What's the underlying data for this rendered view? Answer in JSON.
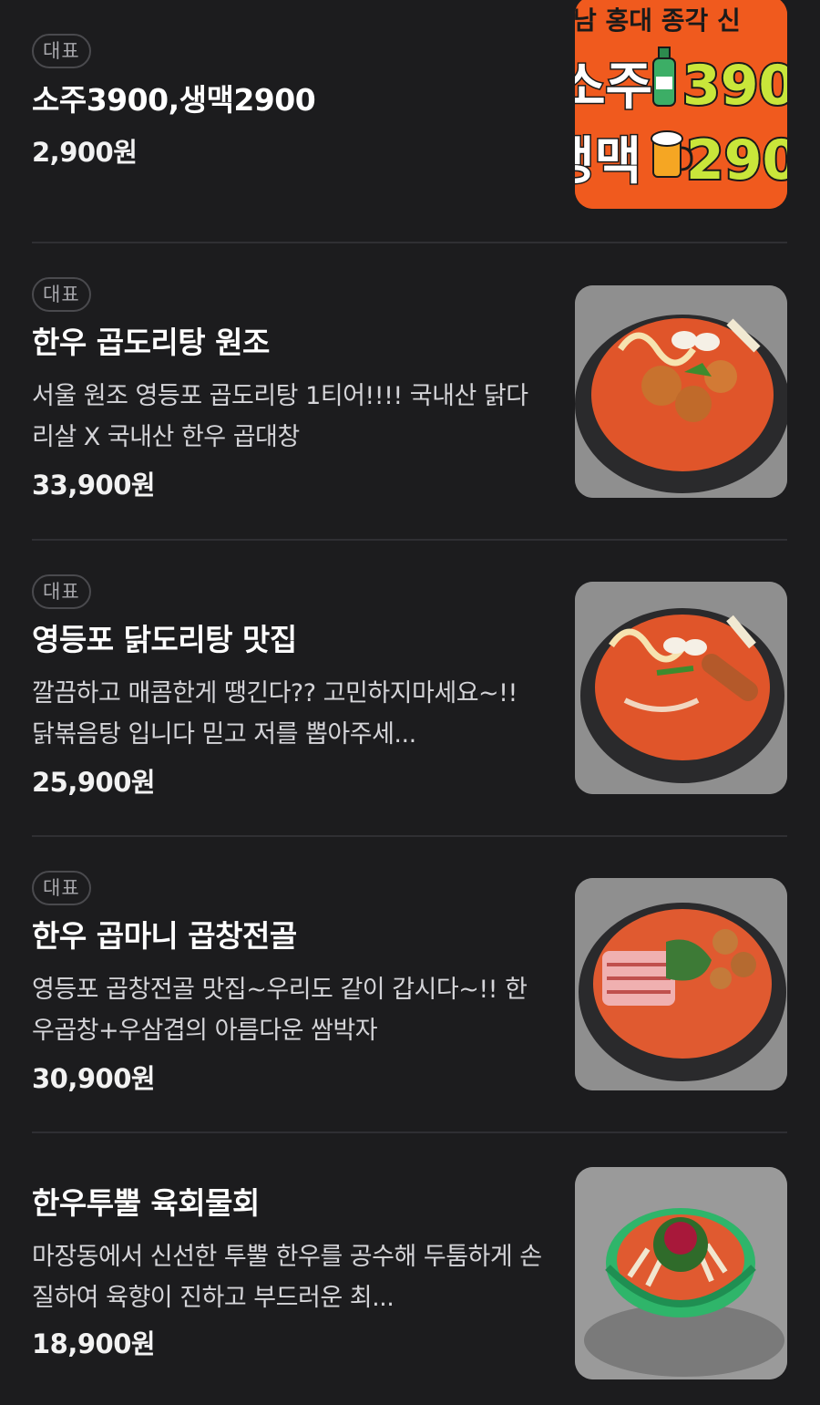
{
  "menu": {
    "badge_label": "대표",
    "items": [
      {
        "badge": "대표",
        "title": "소주3900,생맥2900",
        "description": "",
        "price": "2,900원",
        "image": {
          "top_text": "남 홍대 종각 신",
          "line1_text": "소주",
          "line1_number": "390",
          "line2_text": "생맥",
          "line2_number": "290",
          "bg_color": "#f05a1e",
          "number_color": "#c9e63a"
        }
      },
      {
        "badge": "대표",
        "title": "한우 곱도리탕 원조",
        "description": "서울 원조 영등포 곱도리탕 1티어!!!! 국내산 닭다리살 X 국내산 한우 곱대창",
        "price": "33,900원",
        "image": {
          "icon": "stew-pot-icon"
        }
      },
      {
        "badge": "대표",
        "title": "영등포 닭도리탕 맛집",
        "description": "깔끔하고 매콤한게 땡긴다?? 고민하지마세요~!! 닭볶음탕 입니다 믿고 저를 뽑아주세...",
        "price": "25,900원",
        "image": {
          "icon": "stew-pot-icon"
        }
      },
      {
        "badge": "대표",
        "title": "한우 곱마니 곱창전골",
        "description": "영등포 곱창전골 맛집~우리도 같이 갑시다~!! 한우곱창+우삼겹의 아름다운 쌈박자",
        "price": "30,900원",
        "image": {
          "icon": "stew-pot-icon"
        }
      },
      {
        "badge": "",
        "title": "한우투뿔 육회물회",
        "description": "마장동에서 신선한 투뿔 한우를 공수해 두툼하게 손질하여 육향이 진하고 부드러운 최...",
        "price": "18,900원",
        "image": {
          "icon": "bowl-icon"
        }
      }
    ]
  },
  "colors": {
    "background": "#1c1c1e",
    "divider": "#2f2f33",
    "badge_border": "#4a4a4e",
    "stew_red": "#e0552a",
    "pot_dark": "#2a2a2c",
    "bowl_green": "#2fb56a"
  }
}
